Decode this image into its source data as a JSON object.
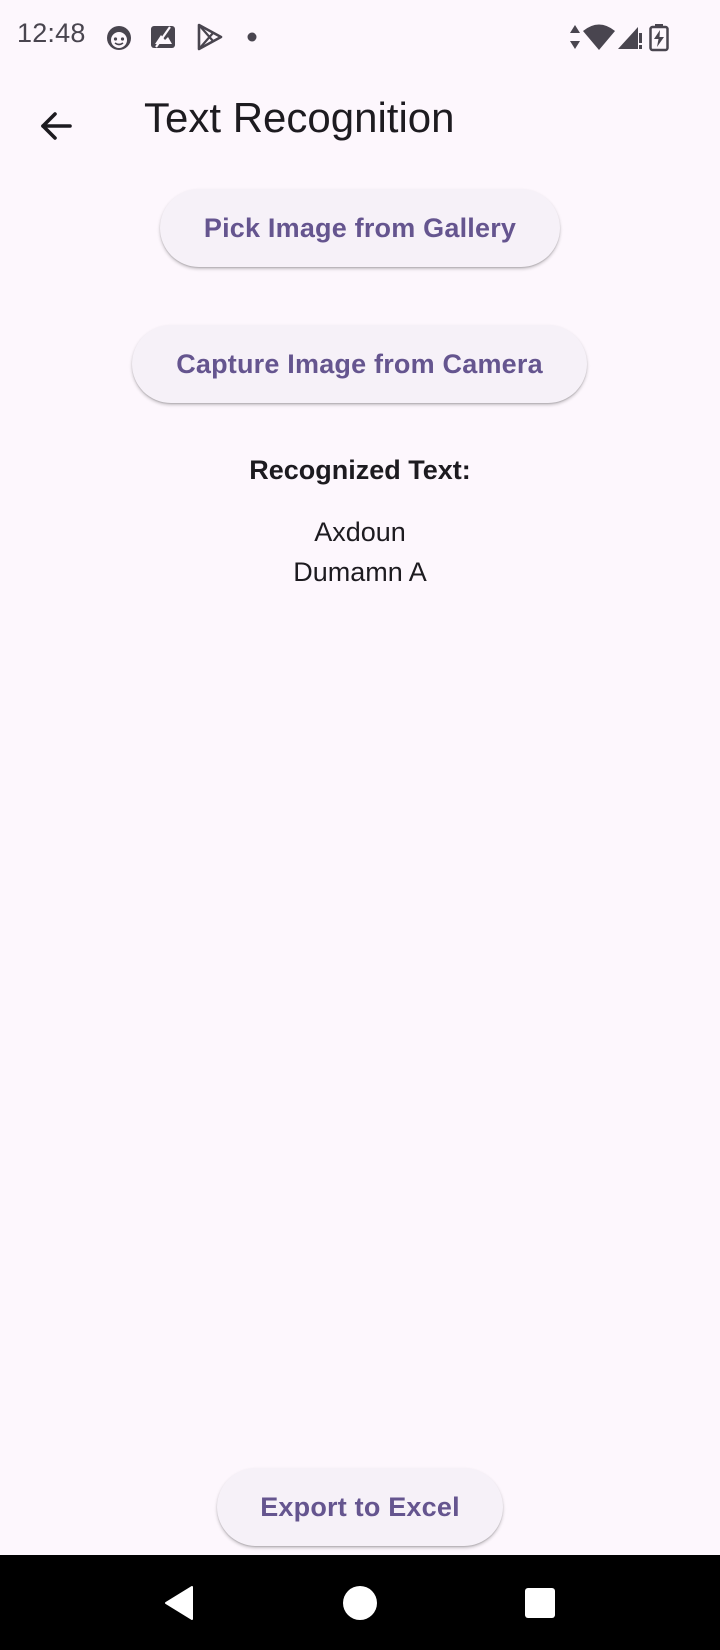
{
  "status_bar": {
    "time": "12:48",
    "left_icons": [
      "face-icon",
      "photo-icon",
      "play-store-icon",
      "dot-icon"
    ],
    "right_icons": [
      "data-arrows-icon",
      "wifi-icon",
      "cell-signal-icon",
      "battery-charging-icon"
    ]
  },
  "app_bar": {
    "title": "Text Recognition",
    "back_icon": "arrow-back-icon"
  },
  "actions": {
    "gallery_label": "Pick Image from Gallery",
    "camera_label": "Capture Image from Camera",
    "export_label": "Export to Excel"
  },
  "result": {
    "heading": "Recognized Text:",
    "lines": [
      "Axdoun",
      "Dumamn A"
    ]
  },
  "nav_bar": {
    "icons": [
      "back-triangle-icon",
      "home-circle-icon",
      "recents-square-icon"
    ]
  },
  "colors": {
    "background": "#fdf7fd",
    "button_bg": "#f6f1f8",
    "accent": "#65558f",
    "text": "#1d1b20",
    "nav_bar": "#000000"
  }
}
